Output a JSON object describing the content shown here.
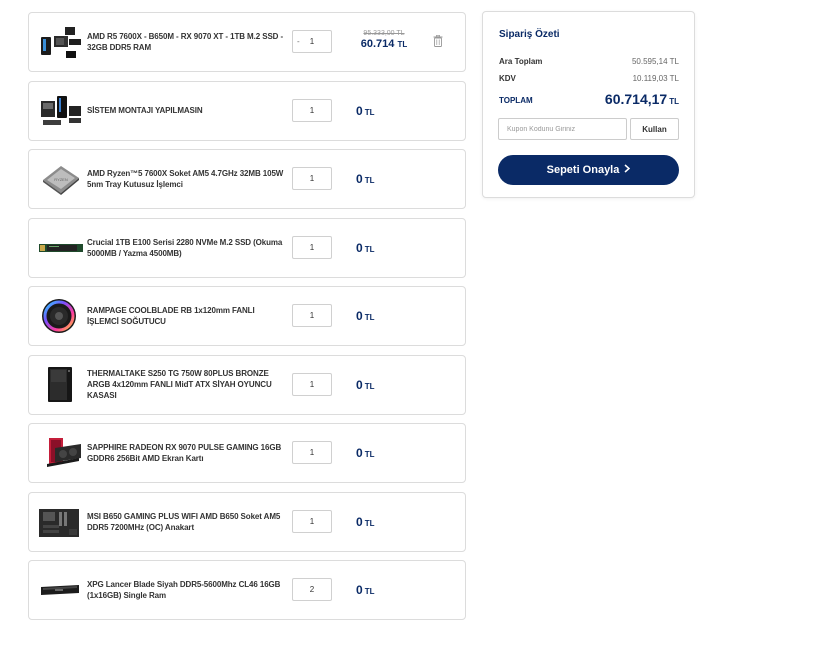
{
  "cart": {
    "items": [
      {
        "name": "AMD R5 7600X - B650M - RX 9070 XT - 1TB M.2 SSD - 32GB DDR5 RAM",
        "qty": "1",
        "qty_minus": "-",
        "old_price": "95.333,00 TL",
        "price": "60.714",
        "currency": "TL",
        "thumb_icon": "pc-bundle-icon",
        "remove_icon": "trash-icon"
      },
      {
        "name": "SİSTEM MONTAJI YAPILMASIN",
        "qty": "1",
        "price": "0",
        "currency": "TL",
        "thumb_icon": "assembly-icon"
      },
      {
        "name": "AMD Ryzen™5 7600X Soket AM5 4.7GHz 32MB 105W 5nm Tray Kutusuz İşlemci",
        "qty": "1",
        "price": "0",
        "currency": "TL",
        "thumb_icon": "cpu-icon"
      },
      {
        "name": "Crucial 1TB E100 Serisi 2280 NVMe M.2 SSD (Okuma 5000MB / Yazma 4500MB)",
        "qty": "1",
        "price": "0",
        "currency": "TL",
        "thumb_icon": "ssd-icon"
      },
      {
        "name": "RAMPAGE COOLBLADE RB 1x120mm FANLI İŞLEMCİ SOĞUTUCU",
        "qty": "1",
        "price": "0",
        "currency": "TL",
        "thumb_icon": "cooler-icon"
      },
      {
        "name": "THERMALTAKE S250 TG 750W 80PLUS BRONZE ARGB 4x120mm FANLI MidT ATX SİYAH OYUNCU KASASI",
        "qty": "1",
        "price": "0",
        "currency": "TL",
        "thumb_icon": "case-icon"
      },
      {
        "name": "SAPPHIRE RADEON RX 9070 PULSE GAMING 16GB GDDR6 256Bit AMD Ekran Kartı",
        "qty": "1",
        "price": "0",
        "currency": "TL",
        "thumb_icon": "gpu-icon"
      },
      {
        "name": "MSI B650 GAMING PLUS WIFI AMD B650 Soket AM5 DDR5 7200MHz (OC) Anakart",
        "qty": "1",
        "price": "0",
        "currency": "TL",
        "thumb_icon": "motherboard-icon"
      },
      {
        "name": "XPG Lancer Blade Siyah DDR5-5600Mhz CL46 16GB (1x16GB) Single Ram",
        "qty": "2",
        "price": "0",
        "currency": "TL",
        "thumb_icon": "ram-icon"
      }
    ]
  },
  "summary": {
    "title": "Sipariş Özeti",
    "subtotal_label": "Ara Toplam",
    "subtotal_value": "50.595,14 TL",
    "vat_label": "KDV",
    "vat_value": "10.119,03 TL",
    "total_label": "TOPLAM",
    "total_value": "60.714,17",
    "total_currency": "TL",
    "coupon_placeholder": "Kupon Kodunu Giriniz",
    "coupon_button": "Kullan",
    "confirm_button": "Sepeti Onayla",
    "confirm_icon": "chevron-right-icon"
  },
  "colors": {
    "brand": "#0a2a66",
    "border": "#dcdcdc",
    "muted": "#999999"
  }
}
